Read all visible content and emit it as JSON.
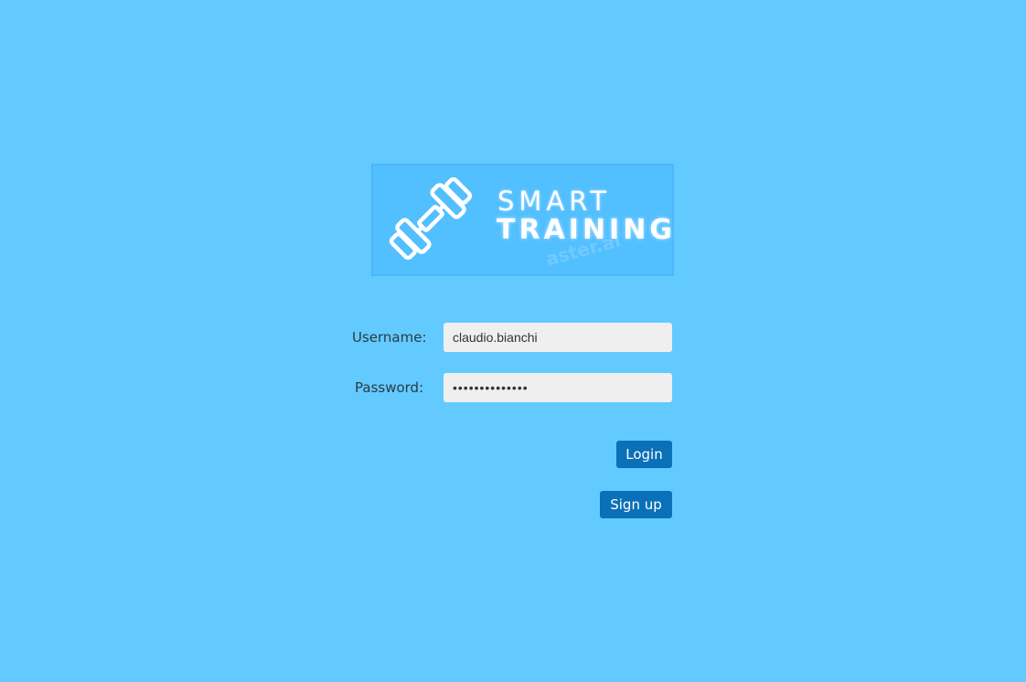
{
  "logo": {
    "line1": "SMART",
    "line2": "TRAINING",
    "watermark": "aster.ai",
    "icon": "dumbbell-icon"
  },
  "form": {
    "username_label": "Username:",
    "username_value": "claudio.bianchi",
    "password_label": "Password:",
    "password_value": "••••••••••••••"
  },
  "buttons": {
    "login_label": "Login",
    "signup_label": "Sign up"
  },
  "colors": {
    "background": "#63caff",
    "button": "#0a70b8",
    "logo_background": "#52bfff"
  }
}
